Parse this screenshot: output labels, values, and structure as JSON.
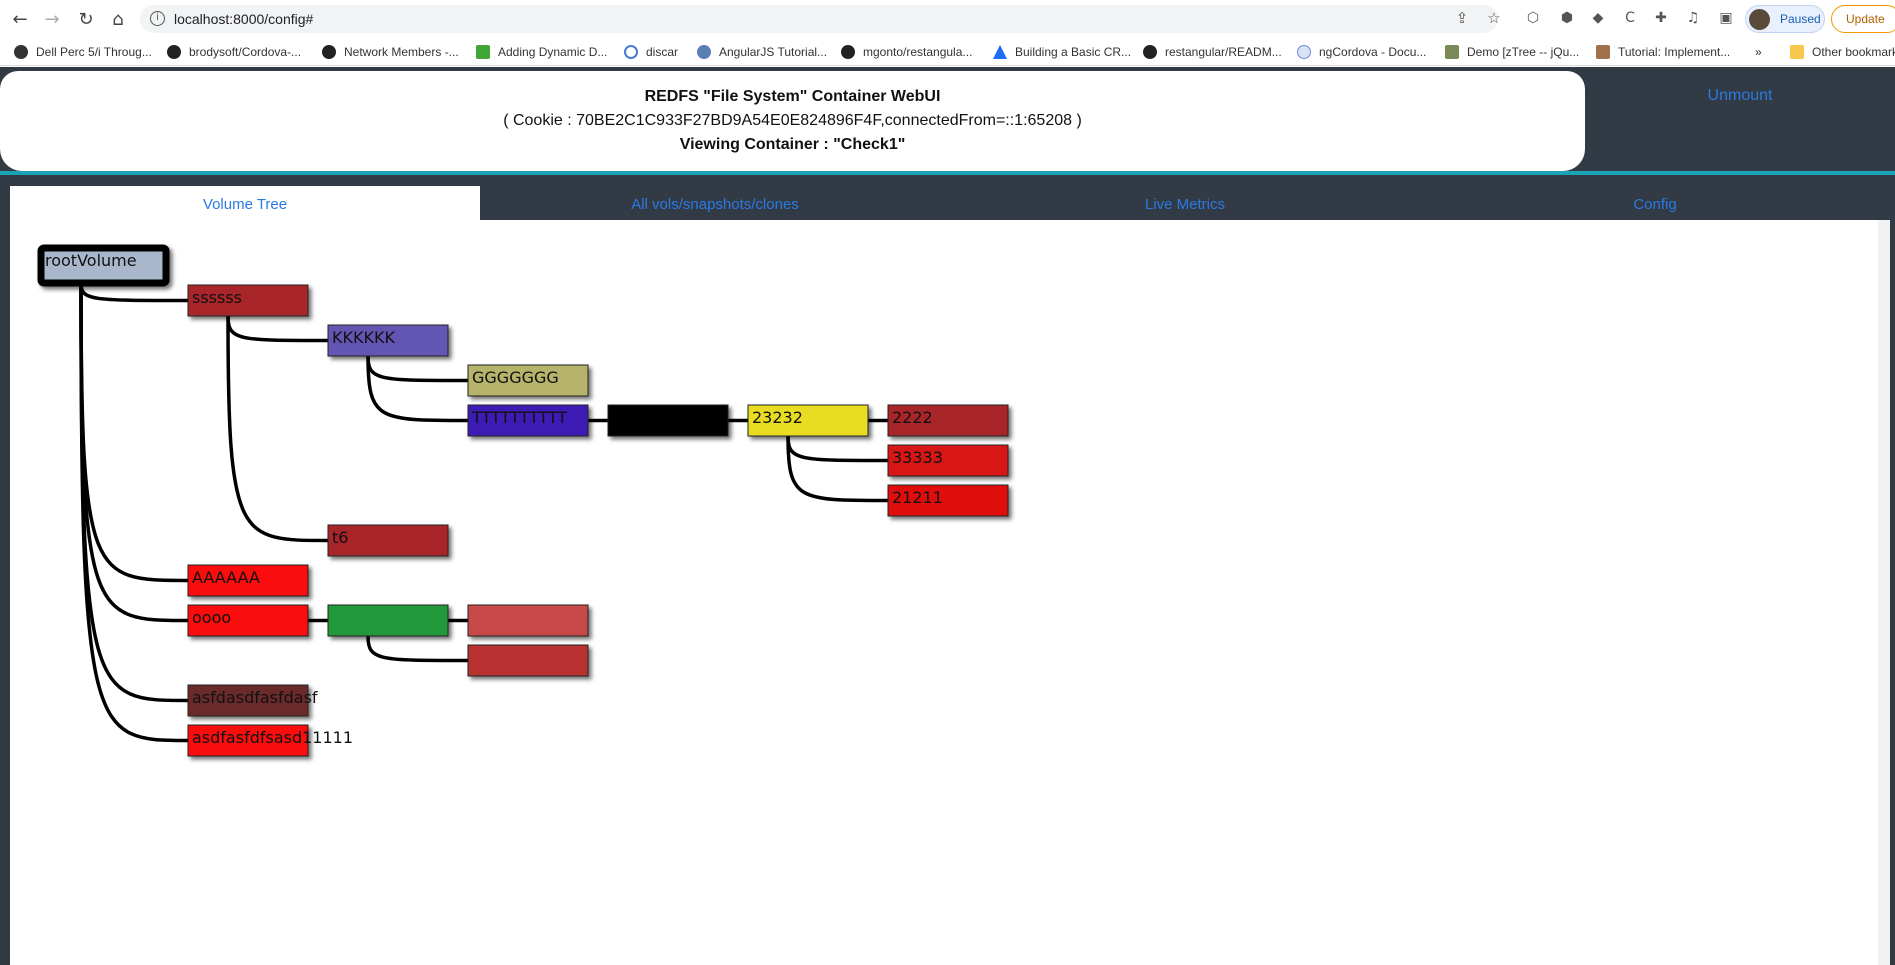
{
  "browser": {
    "url": "localhost:8000/config#",
    "profile_label": "Paused",
    "update_label": "Update",
    "bookmarks": [
      {
        "label": "Dell Perc 5/i Throug..."
      },
      {
        "label": "brodysoft/Cordova-..."
      },
      {
        "label": "Network Members -..."
      },
      {
        "label": "Adding Dynamic D..."
      },
      {
        "label": "discar"
      },
      {
        "label": "AngularJS Tutorial..."
      },
      {
        "label": "mgonto/restangula..."
      },
      {
        "label": "Building a Basic CR..."
      },
      {
        "label": "restangular/READM..."
      },
      {
        "label": "ngCordova - Docu..."
      },
      {
        "label": "Demo [zTree -- jQu..."
      },
      {
        "label": "Tutorial: Implement..."
      }
    ],
    "more_bookmarks": "»",
    "other_bookmarks": "Other bookmarks"
  },
  "header": {
    "title": "REDFS \"File System\" Container WebUI",
    "cookie": "( Cookie : 70BE2C1C933F27BD9A54E0E824896F4F,connectedFrom=::1:65208 )",
    "viewing": "Viewing Container : \"Check1\"",
    "unmount": "Unmount"
  },
  "tabs": [
    {
      "label": "Volume Tree",
      "active": true
    },
    {
      "label": "All vols/snapshots/clones",
      "active": false
    },
    {
      "label": "Live Metrics",
      "active": false
    },
    {
      "label": "Config",
      "active": false
    }
  ],
  "tree": {
    "root": {
      "label": "rootVolume",
      "color": "#a9b7cc"
    },
    "nodes": [
      {
        "id": "ssssss",
        "label": "ssssss",
        "color": "#a8282b"
      },
      {
        "id": "KKKKKK",
        "label": "KKKKKK",
        "color": "#6455b3"
      },
      {
        "id": "GGGGGGG",
        "label": "GGGGGGG",
        "color": "#b5b46a"
      },
      {
        "id": "TTTTT",
        "label": "TTTTTTTTTT",
        "color": "#3d1fb5"
      },
      {
        "id": "black",
        "label": "",
        "color": "#000000"
      },
      {
        "id": "23232",
        "label": "23232",
        "color": "#e8dd20"
      },
      {
        "id": "2222",
        "label": "2222",
        "color": "#a8282b"
      },
      {
        "id": "33333",
        "label": "33333",
        "color": "#d81818"
      },
      {
        "id": "21211",
        "label": "21211",
        "color": "#e01010"
      },
      {
        "id": "t6",
        "label": "t6",
        "color": "#a8282b"
      },
      {
        "id": "AAAAAA",
        "label": "AAAAAA",
        "color": "#fb1010"
      },
      {
        "id": "oooo",
        "label": "oooo",
        "color": "#fb1010"
      },
      {
        "id": "green",
        "label": "",
        "color": "#22993a"
      },
      {
        "id": "lightred",
        "label": "",
        "color": "#c84a4a"
      },
      {
        "id": "midred",
        "label": "",
        "color": "#b93333"
      },
      {
        "id": "asfd",
        "label": "asfdasdfasfdasf",
        "color": "#6b2c2c"
      },
      {
        "id": "asdf",
        "label": "asdfasfdfsasd11111",
        "color": "#fb1010"
      }
    ]
  }
}
